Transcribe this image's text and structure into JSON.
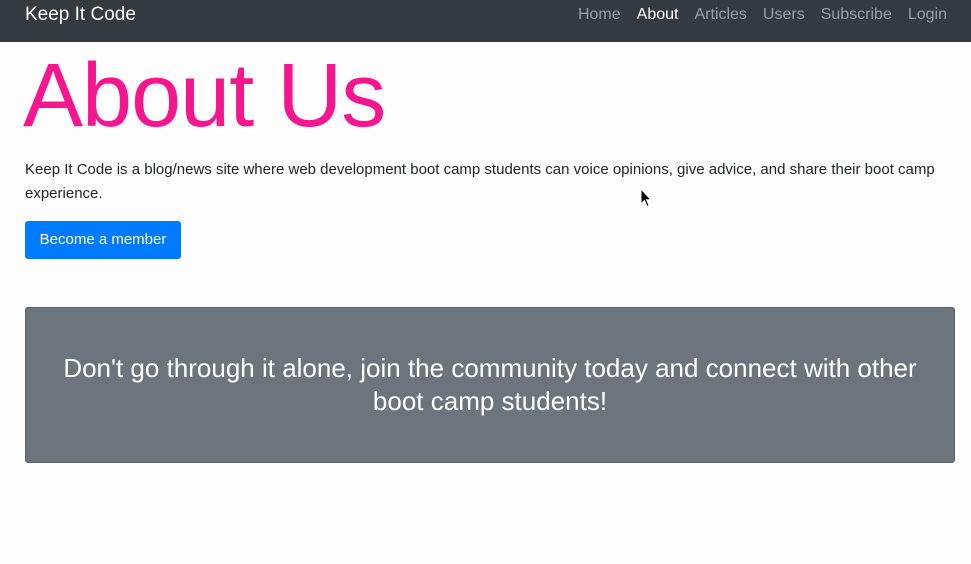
{
  "navbar": {
    "brand": "Keep It Code",
    "links": [
      {
        "label": "Home",
        "active": false
      },
      {
        "label": "About",
        "active": true
      },
      {
        "label": "Articles",
        "active": false
      },
      {
        "label": "Users",
        "active": false
      },
      {
        "label": "Subscribe",
        "active": false
      },
      {
        "label": "Login",
        "active": false
      }
    ]
  },
  "main": {
    "title": "About Us",
    "intro": "Keep It Code is a blog/news site where web development boot camp students can voice opinions, give advice, and share their boot camp experience.",
    "cta_label": "Become a member",
    "callout": "Don't go through it alone, join the community today and connect with other boot camp students!"
  },
  "colors": {
    "navbar_bg": "#343a40",
    "title": "#f5168f",
    "button": "#007bff",
    "callout_bg": "#6c757d"
  },
  "icons": {
    "cursor": "mouse-pointer-icon"
  }
}
